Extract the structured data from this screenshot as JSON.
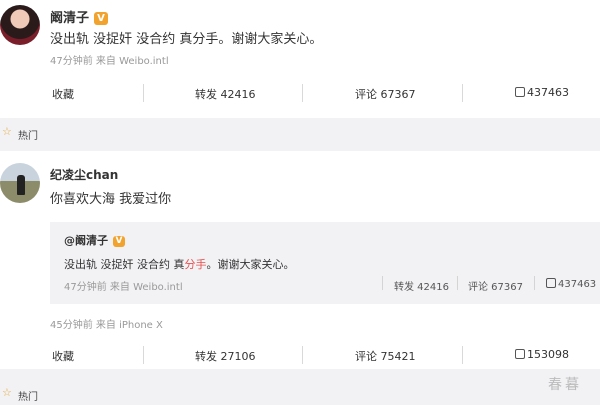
{
  "post1": {
    "username": "阚清子",
    "text": "没出轨 没捉奸 没合约 真分手。谢谢大家关心。",
    "meta": "47分钟前 来自 Weibo.intl",
    "actions": {
      "collect": "收藏",
      "repost": "转发 42416",
      "comment": "评论 67367",
      "like": "437463"
    }
  },
  "hot_label": "热门",
  "post2": {
    "username": "纪凌尘chan",
    "text": "你喜欢大海 我爱过你",
    "meta": "45分钟前 来自 iPhone X",
    "repost": {
      "username": "@阚清子",
      "text_before": "没出轨 没捉奸 没合约 真",
      "text_highlight": "分手",
      "text_after": "。谢谢大家关心。",
      "meta": "47分钟前 来自 Weibo.intl",
      "repost": "转发 42416",
      "comment": "评论 67367",
      "like": "437463"
    },
    "actions": {
      "collect": "收藏",
      "repost": "转发 27106",
      "comment": "评论 75421",
      "like": "153098"
    }
  },
  "watermark": "春暮",
  "colors": {
    "badge": "#f2a32d",
    "highlight": "#e65050",
    "star": "#e8a93c"
  }
}
